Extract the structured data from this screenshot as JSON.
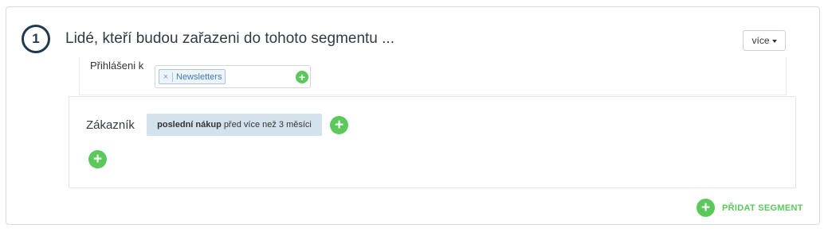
{
  "segment": {
    "step_number": "1",
    "title": "Lidé, kteří budou zařazeni do tohoto segmentu ...",
    "more_label": "více"
  },
  "subscription": {
    "label": "Přihlášeni k",
    "tags": [
      {
        "remove_symbol": "×",
        "label": "Newsletters"
      }
    ]
  },
  "condition": {
    "entity_label": "Zákazník",
    "rule_bold": "poslední nákup",
    "rule_rest": "před více než 3 měsíci"
  },
  "actions": {
    "add_segment_label": "PŘIDAT SEGMENT"
  },
  "colors": {
    "accent_green": "#5cc85c",
    "step_circle": "#1f3a4f",
    "chip_bg": "#d4e2ee",
    "tag_text": "#3a7cb8"
  },
  "icons": {
    "plus": "plus-circle-icon",
    "remove": "close-icon",
    "caret": "caret-down-icon"
  }
}
